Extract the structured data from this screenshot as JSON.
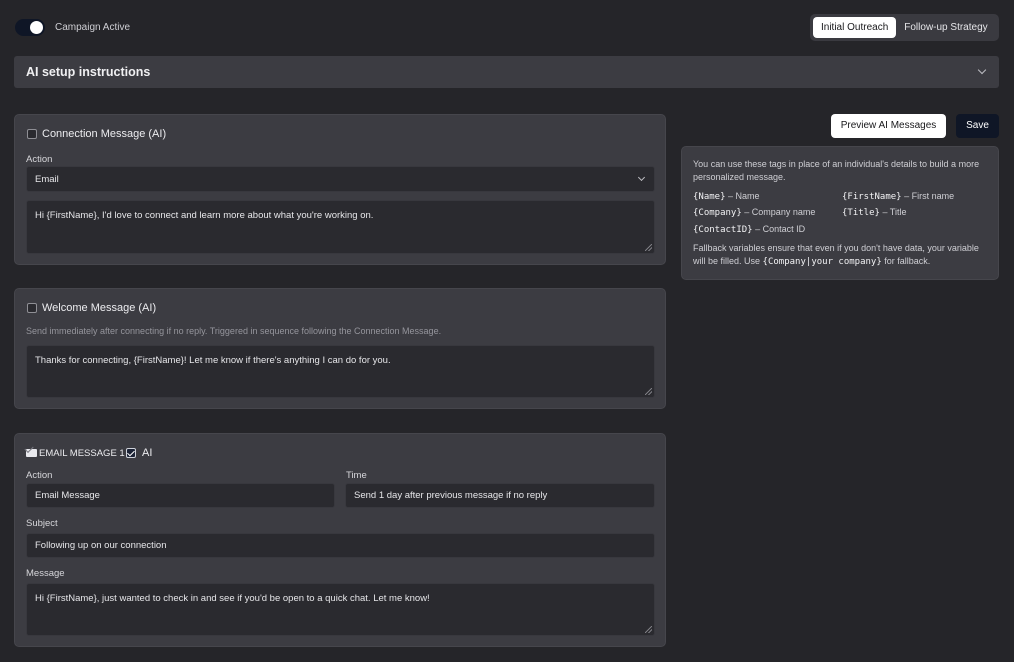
{
  "header": {
    "toggle_label": "Campaign Active",
    "tabs": [
      {
        "label": "Initial Outreach",
        "active": true
      },
      {
        "label": "Follow-up Strategy",
        "active": false
      }
    ]
  },
  "accordion": {
    "title": "AI setup instructions"
  },
  "connection_card": {
    "title": "Connection Message (AI)",
    "action_label": "Action",
    "action_value": "Email",
    "message": "Hi {FirstName}, I'd love to connect and learn more about what you're working on."
  },
  "welcome_card": {
    "title": "Welcome Message (AI)",
    "hint": "Send immediately after connecting if no reply. Triggered in sequence following the Connection Message.",
    "message": "Thanks for connecting, {FirstName}! Let me know if there's anything I can do for you."
  },
  "email_card": {
    "title": "EMAIL MESSAGE 1",
    "ai_label": "AI",
    "action_label": "Action",
    "action_value": "Email Message",
    "time_label": "Time",
    "time_value": "Send 1 day after previous message if no reply",
    "subject_label": "Subject",
    "subject_value": "Following up on our connection",
    "message_label": "Message",
    "message": "Hi {FirstName}, just wanted to check in and see if you'd be open to a quick chat. Let me know!"
  },
  "actions": {
    "preview_label": "Preview AI Messages",
    "save_label": "Save"
  },
  "info": {
    "intro": "You can use these tags in place of an individual's details to build a more personalized message.",
    "tags": [
      {
        "tag": "{Name}",
        "desc": "– Name"
      },
      {
        "tag": "{FirstName}",
        "desc": "– First name"
      },
      {
        "tag": "{Company}",
        "desc": "– Company name"
      },
      {
        "tag": "{Title}",
        "desc": "– Title"
      },
      {
        "tag": "{ContactID}",
        "desc": "– Contact ID"
      }
    ],
    "fallback_pre": "Fallback variables ensure that even if you don't have data, your variable will be filled. Use",
    "fallback_code": "{Company|your company}",
    "fallback_post": "for fallback."
  },
  "colors": {
    "background": "#252529",
    "card": "#3c3c42",
    "accent_dark": "#0f1626"
  }
}
